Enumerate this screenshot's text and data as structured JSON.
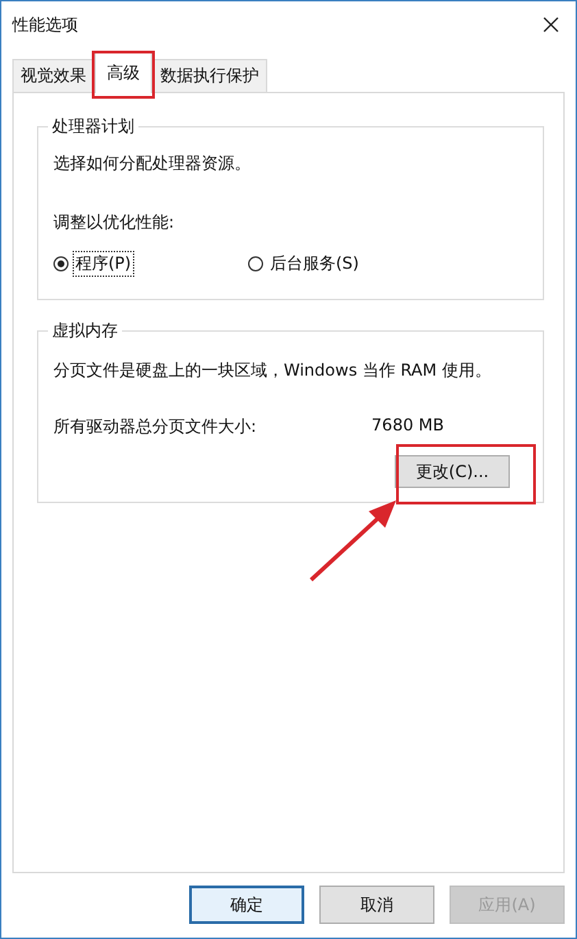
{
  "window": {
    "title": "性能选项"
  },
  "tabs": [
    {
      "label": "视觉效果",
      "selected": false
    },
    {
      "label": "高级",
      "selected": true
    },
    {
      "label": "数据执行保护",
      "selected": false
    }
  ],
  "processor_group": {
    "title": "处理器计划",
    "description": "选择如何分配处理器资源。",
    "prompt": "调整以优化性能:",
    "options": [
      {
        "label": "程序(P)",
        "selected": true
      },
      {
        "label": "后台服务(S)",
        "selected": false
      }
    ]
  },
  "virtual_memory_group": {
    "title": "虚拟内存",
    "description": "分页文件是硬盘上的一块区域，Windows 当作 RAM 使用。",
    "total_label": "所有驱动器总分页文件大小:",
    "total_value": "7680 MB",
    "change_button": "更改(C)..."
  },
  "buttons": [
    {
      "label": "确定",
      "kind": "default",
      "disabled": false
    },
    {
      "label": "取消",
      "kind": "normal",
      "disabled": false
    },
    {
      "label": "应用(A)",
      "kind": "normal",
      "disabled": true
    }
  ]
}
